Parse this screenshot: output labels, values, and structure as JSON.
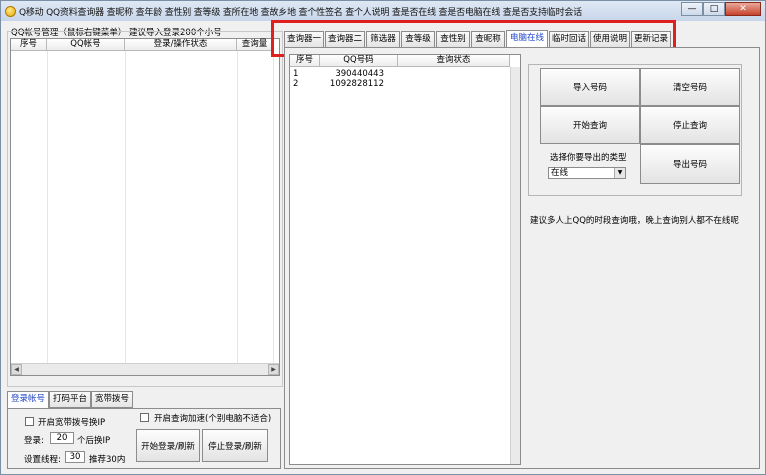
{
  "window": {
    "title": "Q移动 QQ资料查询器 查昵称 查年龄 查性别 查等级 查所在地 查故乡地 查个性签名 查个人说明 查是否在线 查是否电脑在线 查是否支持临时会话",
    "minimize": "—",
    "maximize": "□",
    "close": "✕"
  },
  "left": {
    "group_label": "QQ帐号管理（鼠标右键菜单）",
    "hint": "建议导入登录200个小号",
    "columns": [
      "序号",
      "QQ帐号",
      "登录/操作状态",
      "查询量"
    ]
  },
  "bottom_tabs": [
    "登录帐号",
    "打码平台",
    "宽带拨号"
  ],
  "login_panel": {
    "broadband_label": "开启宽带拨号换IP",
    "accel_label": "开启查询加速(个别电脑不适合)",
    "login_prefix": "登录:",
    "login_count": "20",
    "login_suffix": "个后换IP",
    "threads_prefix": "设置线程:",
    "threads_value": "30",
    "threads_suffix": "推荐30内",
    "start_btn": "开始登录/刷新",
    "stop_btn": "停止登录/刷新"
  },
  "top_tabs": [
    "查询器一",
    "查询器二",
    "筛选器",
    "查等级",
    "查性别",
    "查昵称",
    "电脑在线",
    "临时回话",
    "使用说明",
    "更新记录"
  ],
  "results": {
    "columns": [
      "序号",
      "QQ号码",
      "查询状态"
    ],
    "rows": [
      {
        "no": "1",
        "qq": "390440443",
        "status": ""
      },
      {
        "no": "2",
        "qq": "1092828112",
        "status": ""
      }
    ]
  },
  "actions": {
    "import": "导入号码",
    "clear": "清空号码",
    "start": "开始查询",
    "stop": "停止查询",
    "export_label": "选择你要导出的类型",
    "export_type": "在线",
    "export_btn": "导出号码"
  },
  "tip": "建议多人上QQ的时段查询哦，晚上查询别人都不在线呢",
  "colors": {
    "highlight": "#e0201e",
    "active_tab": "#2045c8"
  }
}
